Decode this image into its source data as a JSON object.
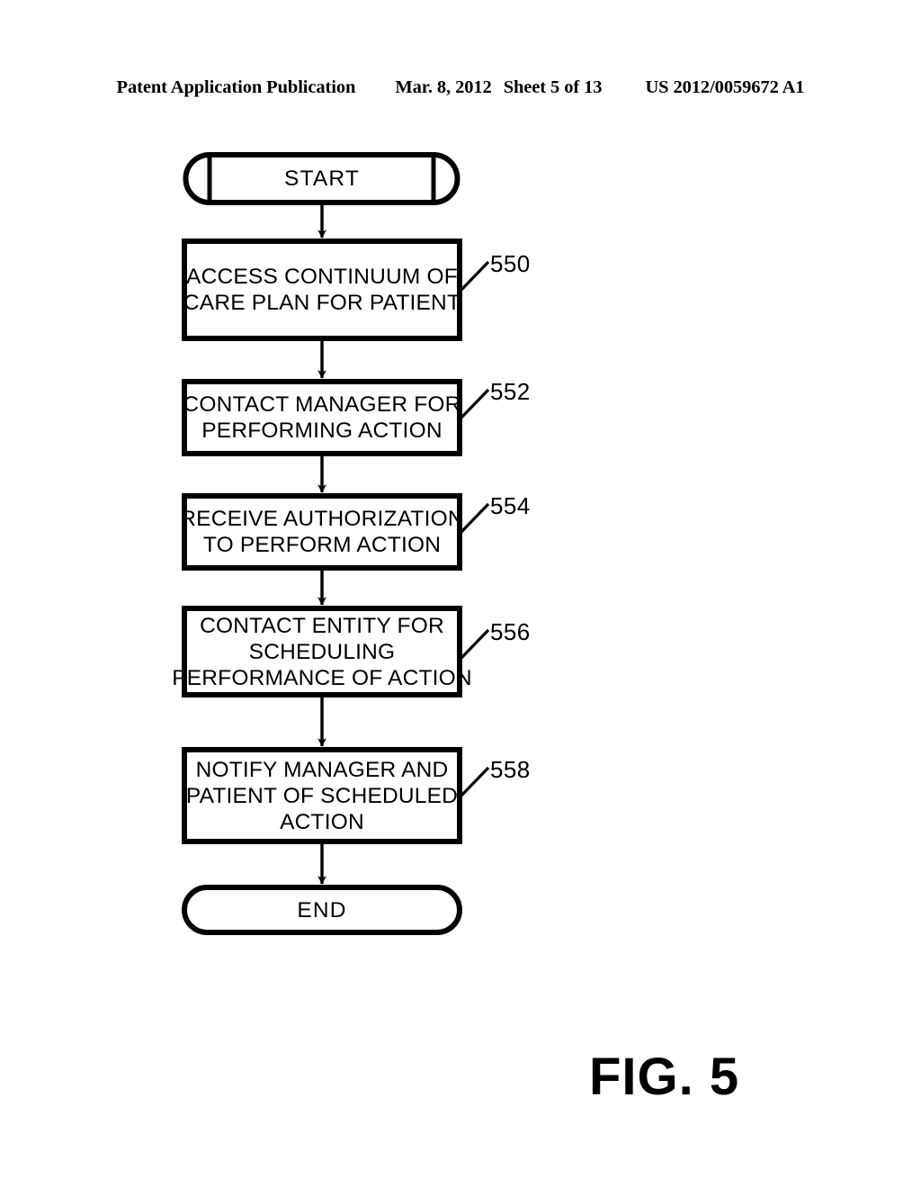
{
  "header": {
    "publication": "Patent Application Publication",
    "date": "Mar. 8, 2012",
    "sheet": "Sheet 5 of 13",
    "patent_number": "US 2012/0059672 A1"
  },
  "figure": {
    "caption": "FIG. 5",
    "type": "flowchart"
  },
  "flowchart": {
    "nodes": [
      {
        "id": "start",
        "shape": "terminal-capsule",
        "label": "START",
        "ref": ""
      },
      {
        "id": "step-550",
        "shape": "process-rect",
        "label": "ACCESS CONTINUUM OF\nCARE PLAN FOR PATIENT",
        "ref": "550"
      },
      {
        "id": "step-552",
        "shape": "process-rect",
        "label": "CONTACT MANAGER FOR\nPERFORMING ACTION",
        "ref": "552"
      },
      {
        "id": "step-554",
        "shape": "process-rect",
        "label": "RECEIVE AUTHORIZATION\nTO PERFORM ACTION",
        "ref": "554"
      },
      {
        "id": "step-556",
        "shape": "process-rect",
        "label": "CONTACT ENTITY FOR\nSCHEDULING\nPERFORMANCE OF ACTION",
        "ref": "556"
      },
      {
        "id": "step-558",
        "shape": "process-rect",
        "label": "NOTIFY MANAGER AND\nPATIENT OF SCHEDULED\nACTION",
        "ref": "558"
      },
      {
        "id": "end",
        "shape": "terminal-rounded",
        "label": "END",
        "ref": ""
      }
    ],
    "edges": [
      {
        "from": "start",
        "to": "step-550",
        "arrow": "down"
      },
      {
        "from": "step-550",
        "to": "step-552",
        "arrow": "down"
      },
      {
        "from": "step-552",
        "to": "step-554",
        "arrow": "down"
      },
      {
        "from": "step-554",
        "to": "step-556",
        "arrow": "down"
      },
      {
        "from": "step-556",
        "to": "step-558",
        "arrow": "down"
      },
      {
        "from": "step-558",
        "to": "end",
        "arrow": "down"
      }
    ]
  },
  "colors": {
    "ink": "#000000",
    "paper": "#ffffff"
  }
}
